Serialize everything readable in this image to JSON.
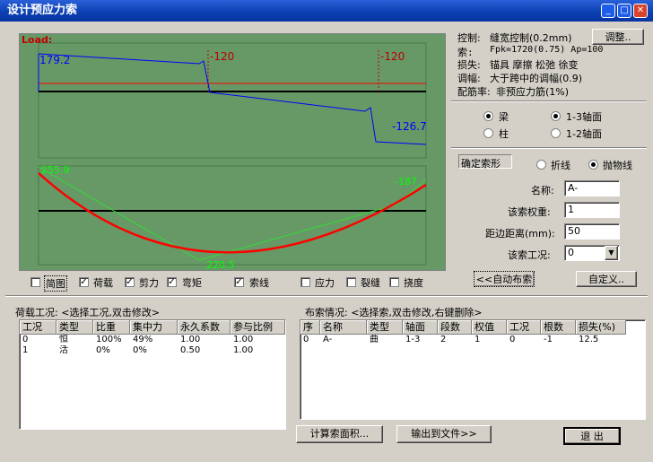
{
  "window": {
    "title": "设计预应力索"
  },
  "chart": {
    "load_label": "Load:",
    "top": {
      "left": "179.2",
      "mid": "-120",
      "mid2": "-120",
      "right": "-126.7"
    },
    "bottom": {
      "left": "255.9",
      "right": "-187",
      "bottom": "220.5"
    }
  },
  "chart_options": [
    {
      "label": "简图",
      "checked": false
    },
    {
      "label": "荷载",
      "checked": true
    },
    {
      "label": "剪力",
      "checked": true
    },
    {
      "label": "弯矩",
      "checked": true
    },
    {
      "label": "索线",
      "checked": true
    },
    {
      "label": "应力",
      "checked": false
    },
    {
      "label": "裂缝",
      "checked": false
    },
    {
      "label": "挠度",
      "checked": false
    }
  ],
  "info": {
    "control_label": "控制:",
    "control_value": "缝宽控制(0.2mm)",
    "adjust_button": "调整..",
    "cable_label": "索:",
    "cable_value": "Fpk=1720(0.75) Ap=100",
    "loss_label": "损失:",
    "loss_value": "锚具 摩擦 松弛 徐变",
    "amp_label": "调幅:",
    "amp_value": "大于跨中的调幅(0.9)",
    "ratio_label": "配筋率:",
    "ratio_value": "非预应力筋(1%)"
  },
  "member": {
    "beam": "梁",
    "column": "柱",
    "axis13": "1-3轴面",
    "axis12": "1-2轴面"
  },
  "shape": {
    "group": "确定索形",
    "polyline": "折线",
    "parabola": "抛物线"
  },
  "form": {
    "name_label": "名称:",
    "name_value": "A-",
    "weight_label": "该索权重:",
    "weight_value": "1",
    "edge_label": "距边距离(mm):",
    "edge_value": "50",
    "case_label": "该索工况:",
    "case_value": "0"
  },
  "buttons": {
    "auto": "<<自动布索",
    "custom": "自定义..",
    "area": "计算索面积...",
    "export": "输出到文件>>",
    "exit": "退  出"
  },
  "load_table": {
    "caption": "荷载工况: <选择工况,双击修改>",
    "headers": [
      "工况",
      "类型",
      "比重",
      "集中力",
      "永久系数",
      "参与比例"
    ],
    "rows": [
      [
        "0",
        "恒",
        "100%",
        "49%",
        "1.00",
        "1.00"
      ],
      [
        "1",
        "活",
        "0%",
        "0%",
        "0.50",
        "1.00"
      ]
    ]
  },
  "cable_table": {
    "caption": "布索情况: <选择索,双击修改,右键删除>",
    "headers": [
      "序",
      "名称",
      "类型",
      "轴面",
      "段数",
      "权值",
      "工况",
      "根数",
      "损失(%)"
    ],
    "rows": [
      [
        "0",
        "A-",
        "曲",
        "1-3",
        "2",
        "1",
        "0",
        "-1",
        "12.5"
      ]
    ]
  },
  "colors": {
    "plot_bg": "#669966",
    "top_line": "#0000ff",
    "curve": "#ff0000",
    "label_red": "#c00000",
    "label_green": "#00ff00"
  }
}
